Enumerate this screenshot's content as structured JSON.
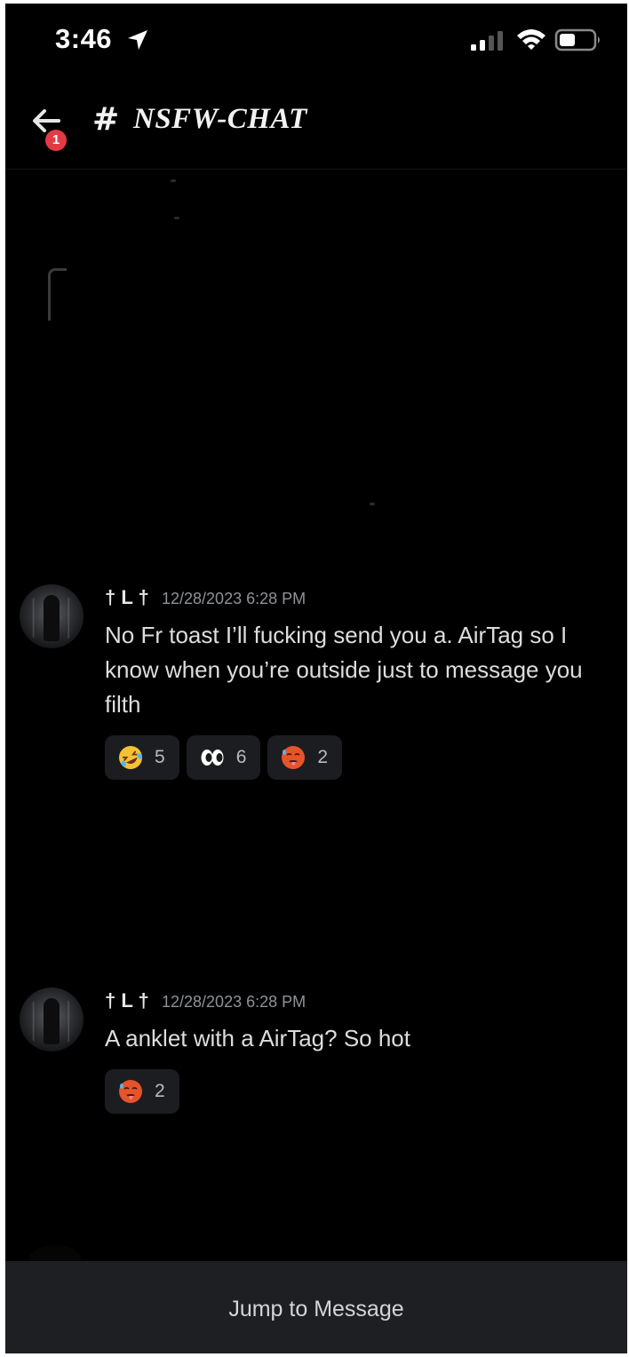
{
  "status_bar": {
    "time": "3:46",
    "location_icon": "location-arrow-icon",
    "signal_icon": "cellular-signal-icon",
    "wifi_icon": "wifi-icon",
    "battery_icon": "battery-icon"
  },
  "header": {
    "back_icon": "arrow-left-icon",
    "notification_count": "1",
    "channel_hash": "#",
    "channel_name": "NSFW-CHAT"
  },
  "messages": [
    {
      "author": "† L †",
      "timestamp": "12/28/2023 6:28 PM",
      "text": "No Fr toast I’ll fucking send you a. AirTag so I know when you’re outside just to message you filth",
      "reactions": [
        {
          "emoji": "rolling-on-floor-laughing-icon",
          "count": "5"
        },
        {
          "emoji": "eyes-icon",
          "count": "6"
        },
        {
          "emoji": "hot-face-icon",
          "count": "2"
        }
      ]
    },
    {
      "author": "† L †",
      "timestamp": "12/28/2023 6:28 PM",
      "text": "A anklet with a AirTag? So hot",
      "reactions": [
        {
          "emoji": "hot-face-icon",
          "count": "2"
        }
      ]
    }
  ],
  "jump_bar": {
    "label": "Jump to Message"
  },
  "colors": {
    "background": "#000000",
    "badge": "#e23b44",
    "reaction_bg": "#1c1d20",
    "jump_bar_bg": "#1e1f22",
    "timestamp": "#8e9297"
  }
}
